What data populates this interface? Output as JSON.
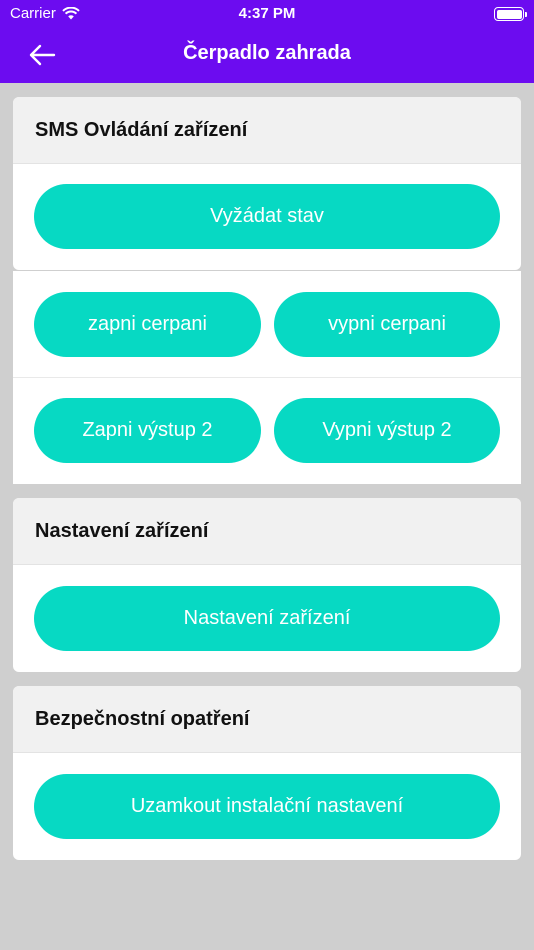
{
  "status_bar": {
    "carrier": "Carrier",
    "time": "4:37 PM"
  },
  "nav": {
    "title": "Čerpadlo zahrada",
    "back_icon": "arrow-left-icon"
  },
  "colors": {
    "nav_bg": "#6c0cf0",
    "button_bg": "#07d9c3",
    "page_bg": "#cfcfcf"
  },
  "sections": {
    "sms": {
      "title": "SMS Ovládání zařízení",
      "request_status": "Vyžádat stav",
      "pump_on": "zapni cerpani",
      "pump_off": "vypni cerpani",
      "output2_on": "Zapni výstup 2",
      "output2_off": "Vypni výstup 2"
    },
    "settings": {
      "title": "Nastavení zařízení",
      "button": "Nastavení zařízení"
    },
    "security": {
      "title": "Bezpečnostní opatření",
      "button": "Uzamkout instalační nastavení"
    }
  }
}
